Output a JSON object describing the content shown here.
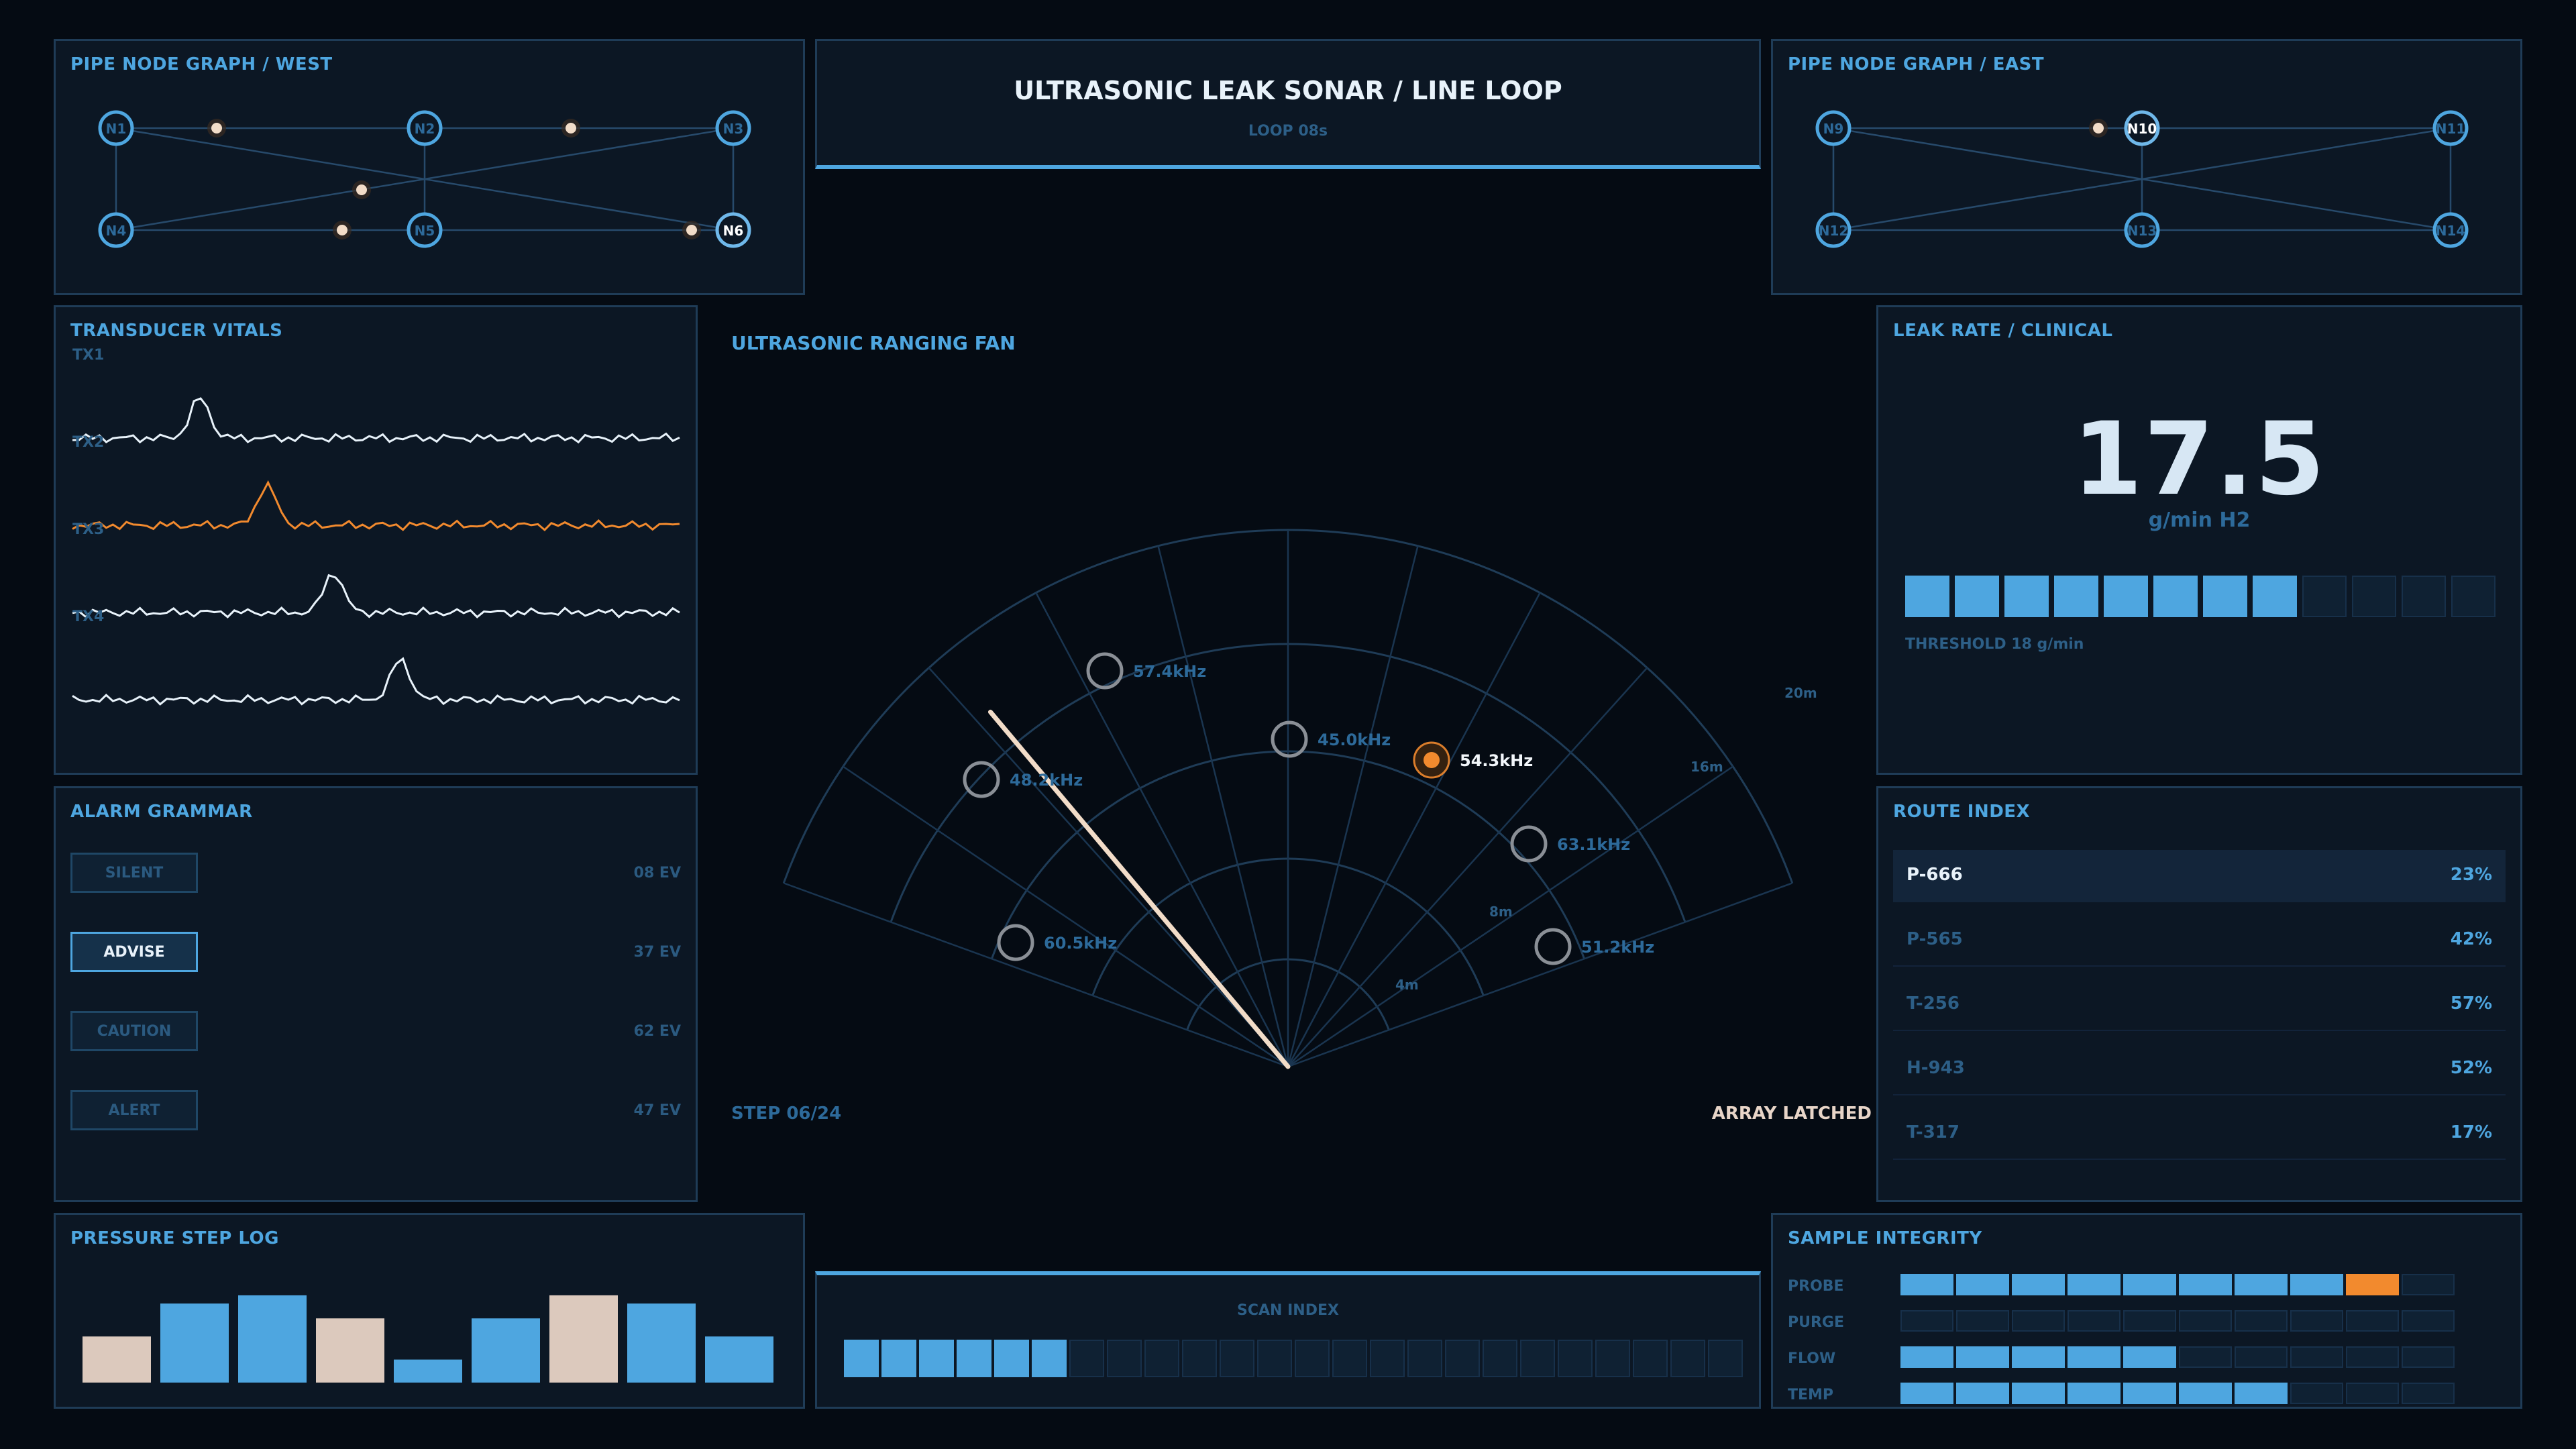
{
  "header": {
    "title": "ULTRASONIC LEAK SONAR / LINE LOOP",
    "subtitle": "LOOP 08s"
  },
  "pipe_west": {
    "title": "PIPE NODE GRAPH / WEST",
    "nodes": [
      "N1",
      "N2",
      "N3",
      "N4",
      "N5",
      "N6"
    ],
    "highlighted": "N6"
  },
  "pipe_east": {
    "title": "PIPE NODE GRAPH / EAST",
    "nodes": [
      "N9",
      "N10",
      "N11",
      "N12",
      "N13",
      "N14"
    ],
    "highlighted": "N10"
  },
  "vitals": {
    "title": "TRANSDUCER VITALS",
    "channels": [
      {
        "name": "TX1",
        "color": "#e8f2fa"
      },
      {
        "name": "TX2",
        "color": "#f28a2e"
      },
      {
        "name": "TX3",
        "color": "#e8f2fa"
      },
      {
        "name": "TX4",
        "color": "#e8f2fa"
      }
    ]
  },
  "alarm": {
    "title": "ALARM GRAMMAR",
    "items": [
      {
        "label": "SILENT",
        "count": "08 EV",
        "active": false
      },
      {
        "label": "ADVISE",
        "count": "37 EV",
        "active": true
      },
      {
        "label": "CAUTION",
        "count": "62 EV",
        "active": false
      },
      {
        "label": "ALERT",
        "count": "47 EV",
        "active": false
      }
    ]
  },
  "sonar": {
    "title": "ULTRASONIC RANGING FAN",
    "step": "STEP 06/24",
    "status": "ARRAY LATCHED",
    "ranges": [
      "4m",
      "8m",
      "16m",
      "20m"
    ],
    "contacts": [
      {
        "label": "57.4kHz",
        "active": false
      },
      {
        "label": "45.0kHz",
        "active": false
      },
      {
        "label": "54.3kHz",
        "active": true
      },
      {
        "label": "48.2kHz",
        "active": false
      },
      {
        "label": "63.1kHz",
        "active": false
      },
      {
        "label": "60.5kHz",
        "active": false
      },
      {
        "label": "51.2kHz",
        "active": false
      }
    ]
  },
  "leak": {
    "title": "LEAK RATE / CLINICAL",
    "value": "17.5",
    "unit": "g/min H2",
    "threshold": "THRESHOLD 18 g/min",
    "segments_total": 12,
    "segments_on": 8
  },
  "routes": {
    "title": "ROUTE INDEX",
    "items": [
      {
        "id": "P-666",
        "pct": "23%",
        "active": true
      },
      {
        "id": "P-565",
        "pct": "42%",
        "active": false
      },
      {
        "id": "T-256",
        "pct": "57%",
        "active": false
      },
      {
        "id": "H-943",
        "pct": "52%",
        "active": false
      },
      {
        "id": "T-317",
        "pct": "17%",
        "active": false
      }
    ]
  },
  "pressure": {
    "title": "PRESSURE STEP LOG",
    "values": [
      28,
      48,
      53,
      39,
      14,
      39,
      53,
      48,
      28
    ],
    "colors": [
      "#dcc9bd",
      "#4ea6e0",
      "#4ea6e0",
      "#dcc9bd",
      "#4ea6e0",
      "#4ea6e0",
      "#dcc9bd",
      "#4ea6e0",
      "#4ea6e0"
    ]
  },
  "scan": {
    "title": "SCAN INDEX",
    "total": 24,
    "on": 6
  },
  "integrity": {
    "title": "SAMPLE INTEGRITY",
    "rows": [
      {
        "label": "PROBE",
        "on": 8,
        "warn_index": 8
      },
      {
        "label": "PURGE",
        "on": 0,
        "warn_index": -1
      },
      {
        "label": "FLOW",
        "on": 5,
        "warn_index": -1
      },
      {
        "label": "TEMP",
        "on": 7,
        "warn_index": -1
      }
    ],
    "total": 10
  }
}
